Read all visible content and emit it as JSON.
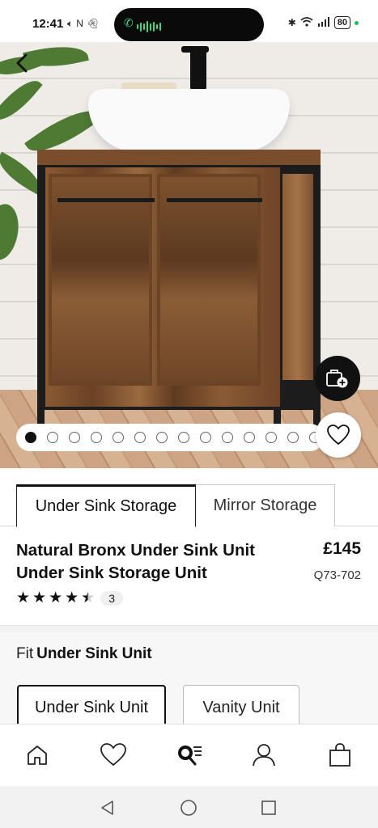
{
  "status_bar": {
    "time": "12:41",
    "battery": "80"
  },
  "gallery": {
    "dot_count": 14,
    "active_index": 0
  },
  "tabs": [
    {
      "label": "Under Sink Storage",
      "active": true
    },
    {
      "label": "Mirror Storage",
      "active": false
    }
  ],
  "product": {
    "title_line1": "Natural Bronx Under Sink Unit",
    "title_line2": "Under Sink Storage Unit",
    "price": "£145",
    "code": "Q73-702",
    "rating": 4.5,
    "review_count": "3"
  },
  "fit": {
    "label": "Fit",
    "selected_value": "Under Sink Unit",
    "options": [
      "Under Sink Unit",
      "Vanity Unit"
    ]
  },
  "bottom_nav": [
    "home-icon",
    "heart-icon",
    "search-list-icon",
    "account-icon",
    "bag-icon"
  ],
  "colors": {
    "primary": "#111111",
    "divider": "#f1f1f1"
  }
}
